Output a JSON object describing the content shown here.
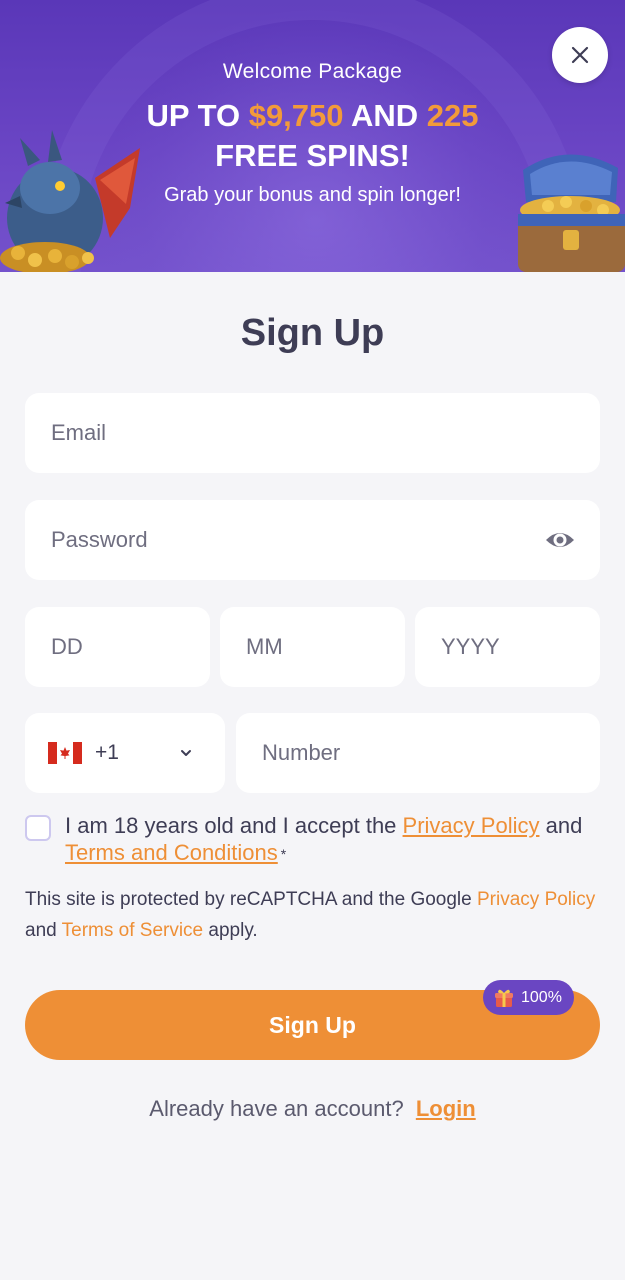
{
  "banner": {
    "subtitle": "Welcome Package",
    "headline_up_to": "UP TO",
    "headline_amount": "$9,750",
    "headline_and": "AND",
    "headline_spins_count": "225",
    "headline_free_spins": "FREE SPINS!",
    "tagline": "Grab your bonus and spin longer!"
  },
  "form": {
    "title": "Sign Up",
    "email_placeholder": "Email",
    "password_placeholder": "Password",
    "dob_day_placeholder": "DD",
    "dob_month_placeholder": "MM",
    "dob_year_placeholder": "YYYY",
    "country_code": "+1",
    "phone_placeholder": "Number",
    "terms_prefix": "I am 18 years old and I accept the",
    "privacy_policy_link": "Privacy Policy",
    "terms_and": "and",
    "terms_link": "Terms and Conditions",
    "required_mark": "*",
    "recaptcha_prefix": "This site is protected by reCAPTCHA and the Google",
    "recaptcha_privacy_link": "Privacy Policy",
    "recaptcha_and": "and",
    "recaptcha_terms_link": "Terms of Service",
    "recaptcha_suffix": "apply.",
    "signup_button": "Sign Up",
    "bonus_badge": "100%",
    "login_prompt": "Already have an account?",
    "login_link": "Login"
  },
  "icons": {
    "close": "close-icon",
    "eye": "eye-icon",
    "flag": "canada-flag-icon",
    "chevron": "chevron-down-icon",
    "gift": "gift-icon"
  },
  "colors": {
    "banner_purple": "#5a37b8",
    "accent_orange": "#ee8f36",
    "badge_purple": "#6a46c2",
    "text_dark": "#3e3d55",
    "page_bg": "#f5f5f8"
  }
}
